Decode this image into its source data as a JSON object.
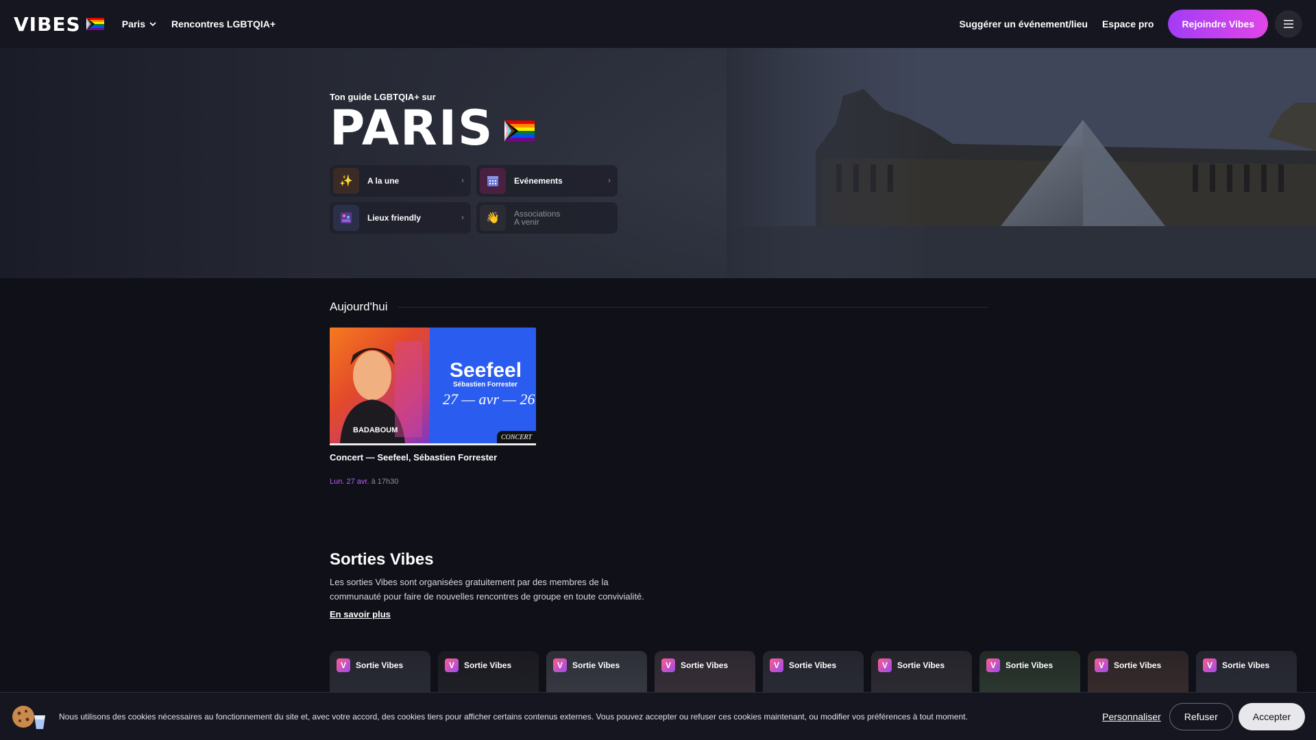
{
  "header": {
    "logo": "VIBES",
    "city_selector": "Paris",
    "nav_meetups": "Rencontres LGBTQIA+",
    "nav_suggest": "Suggérer un événement/lieu",
    "nav_pro": "Espace pro",
    "join_button": "Rejoindre Vibes"
  },
  "hero": {
    "subtitle": "Ton guide LGBTQIA+ sur",
    "title": "PARIS",
    "cards": [
      {
        "label": "A la une",
        "icon": "sparkles-icon"
      },
      {
        "label": "Evénements",
        "icon": "calendar-icon"
      },
      {
        "label": "Lieux friendly",
        "icon": "venue-icon"
      },
      {
        "label": "Associations",
        "sublabel": "A venir",
        "icon": "wave-hand-icon"
      }
    ]
  },
  "today": {
    "heading": "Aujourd'hui",
    "event": {
      "image_artist": "Seefeel",
      "image_subtitle": "Sébastien Forrester",
      "image_date": "27 — avr — 26",
      "image_venue": "BADABOUM",
      "tag": "CONCERT",
      "title": "Concert — Seefeel, Sébastien Forrester",
      "day": "Lun. 27 avr.",
      "time": "à 17h30"
    }
  },
  "sorties": {
    "heading": "Sorties Vibes",
    "description": "Les sorties Vibes sont organisées gratuitement par des membres de la communauté pour faire de nouvelles rencontres de groupe en toute convivialité.",
    "learn_more": "En savoir plus",
    "chip_label": "Sortie Vibes",
    "chips": [
      "Sortie Vibes",
      "Sortie Vibes",
      "Sortie Vibes",
      "Sortie Vibes",
      "Sortie Vibes",
      "Sortie Vibes",
      "Sortie Vibes",
      "Sortie Vibes",
      "Sortie Vibes"
    ]
  },
  "cookie": {
    "text": "Nous utilisons des cookies nécessaires au fonctionnement du site et, avec votre accord, des cookies tiers pour afficher certains contenus externes. Vous pouvez accepter ou refuser ces cookies maintenant, ou modifier vos préférences à tout moment.",
    "customize": "Personnaliser",
    "refuse": "Refuser",
    "accept": "Accepter"
  },
  "colors": {
    "background": "#0f1018",
    "accent_gradient_start": "#a23cf5",
    "accent_gradient_end": "#e046e8",
    "date_accent": "#c05cff"
  }
}
